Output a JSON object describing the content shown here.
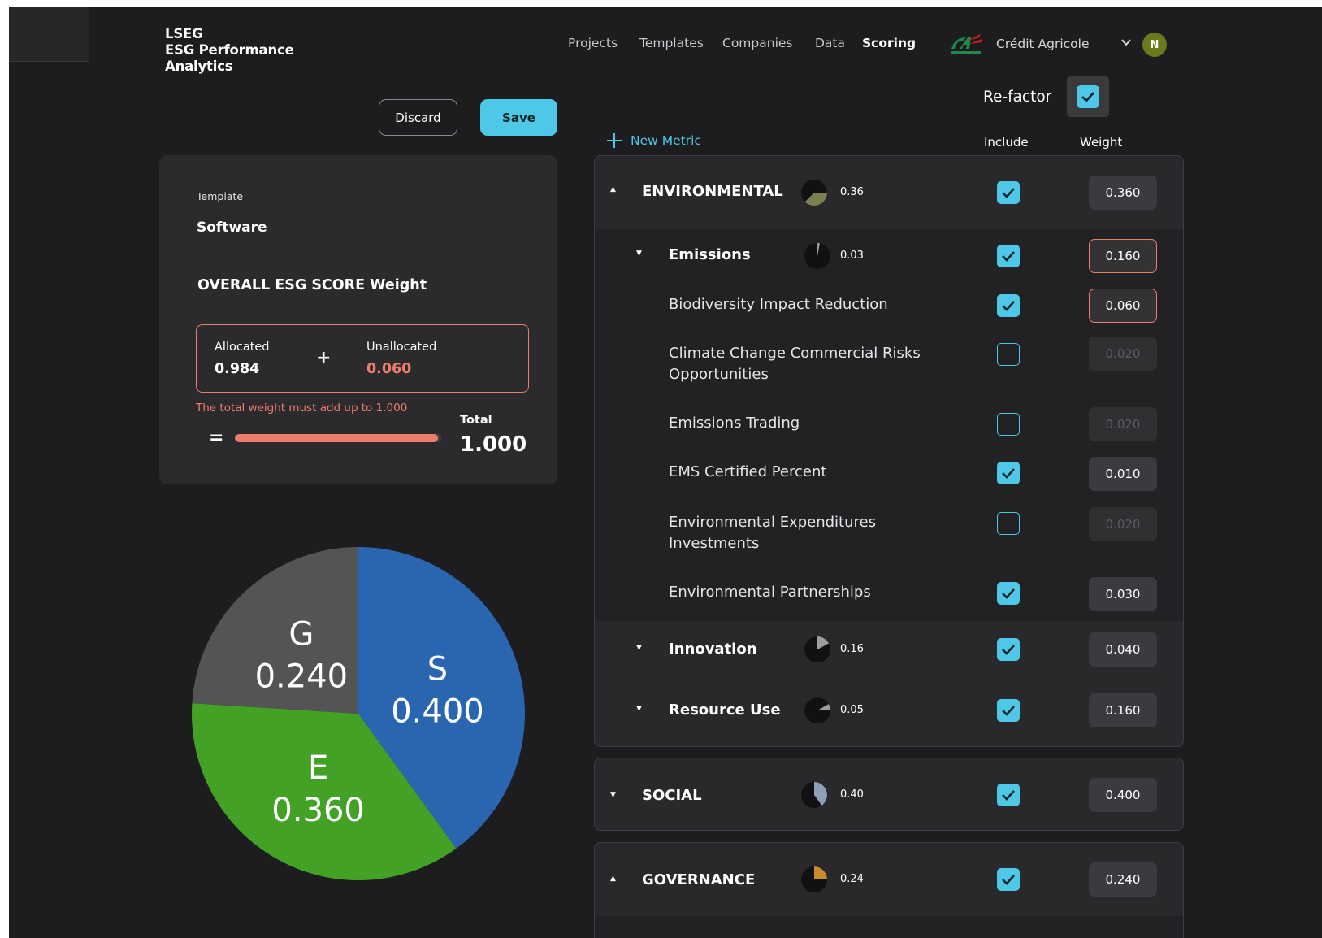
{
  "app": {
    "logo_line1": "LSEG",
    "logo_line2": "ESG Performance",
    "logo_line3": "Analytics"
  },
  "nav": {
    "projects": "Projects",
    "templates": "Templates",
    "companies": "Companies",
    "data": "Data",
    "scoring": "Scoring",
    "company_name": "Crédit Agricole",
    "avatar_initial": "N",
    "brand_green": "#1f8a4c",
    "brand_red": "#e2231a"
  },
  "actions": {
    "discard": "Discard",
    "save": "Save"
  },
  "summary": {
    "template_label": "Template",
    "template_value": "Software",
    "overall_title": "OVERALL ESG SCORE Weight",
    "allocated_label": "Allocated",
    "allocated_value": "0.984",
    "unallocated_label": "Unallocated",
    "unallocated_value": "0.060",
    "plus": "+",
    "equals": "=",
    "error_message": "The total weight must add up to 1.000",
    "total_label": "Total",
    "total_value": "1.000",
    "progress_fraction": 0.984
  },
  "chart_data": {
    "type": "pie",
    "slices": [
      {
        "label": "S",
        "value": 0.4,
        "display": "0.400",
        "color": "#2a66b0"
      },
      {
        "label": "E",
        "value": 0.36,
        "display": "0.360",
        "color": "#43a225"
      },
      {
        "label": "G",
        "value": 0.24,
        "display": "0.240",
        "color": "#545457"
      }
    ]
  },
  "scoring": {
    "refactor_label": "Re-factor",
    "refactor_checked": true,
    "new_metric": "New Metric",
    "col_include": "Include",
    "col_weight": "Weight",
    "environmental": {
      "name": "ENVIRONMENTAL",
      "mini_value": "0.36",
      "weight": "0.360",
      "include": true,
      "subcategories": {
        "emissions": {
          "name": "Emissions",
          "mini_value": "0.03",
          "weight": "0.160",
          "include": true
        },
        "innovation": {
          "name": "Innovation",
          "mini_value": "0.16",
          "weight": "0.040",
          "include": true
        },
        "resource_use": {
          "name": "Resource Use",
          "mini_value": "0.05",
          "weight": "0.160",
          "include": true
        }
      },
      "metrics": [
        {
          "name": "Biodiversity Impact Reduction",
          "weight": "0.060",
          "include": true
        },
        {
          "name": "Climate Change Commercial Risks Opportunities",
          "weight": "0.020",
          "include": false
        },
        {
          "name": "Emissions Trading",
          "weight": "0.020",
          "include": false
        },
        {
          "name": "EMS Certified Percent",
          "weight": "0.010",
          "include": true
        },
        {
          "name": "Environmental Expenditures Investments",
          "weight": "0.020",
          "include": false
        },
        {
          "name": "Environmental Partnerships",
          "weight": "0.030",
          "include": true
        }
      ]
    },
    "social": {
      "name": "SOCIAL",
      "mini_value": "0.40",
      "weight": "0.400",
      "include": true
    },
    "governance": {
      "name": "GOVERNANCE",
      "mini_value": "0.24",
      "weight": "0.240",
      "include": true
    }
  },
  "colors": {
    "accent": "#4ec8e6",
    "error": "#ef7d6c",
    "mini_env": "#7d7f52",
    "mini_soc": "#8ea0b8",
    "mini_gov": "#c98a2a"
  }
}
